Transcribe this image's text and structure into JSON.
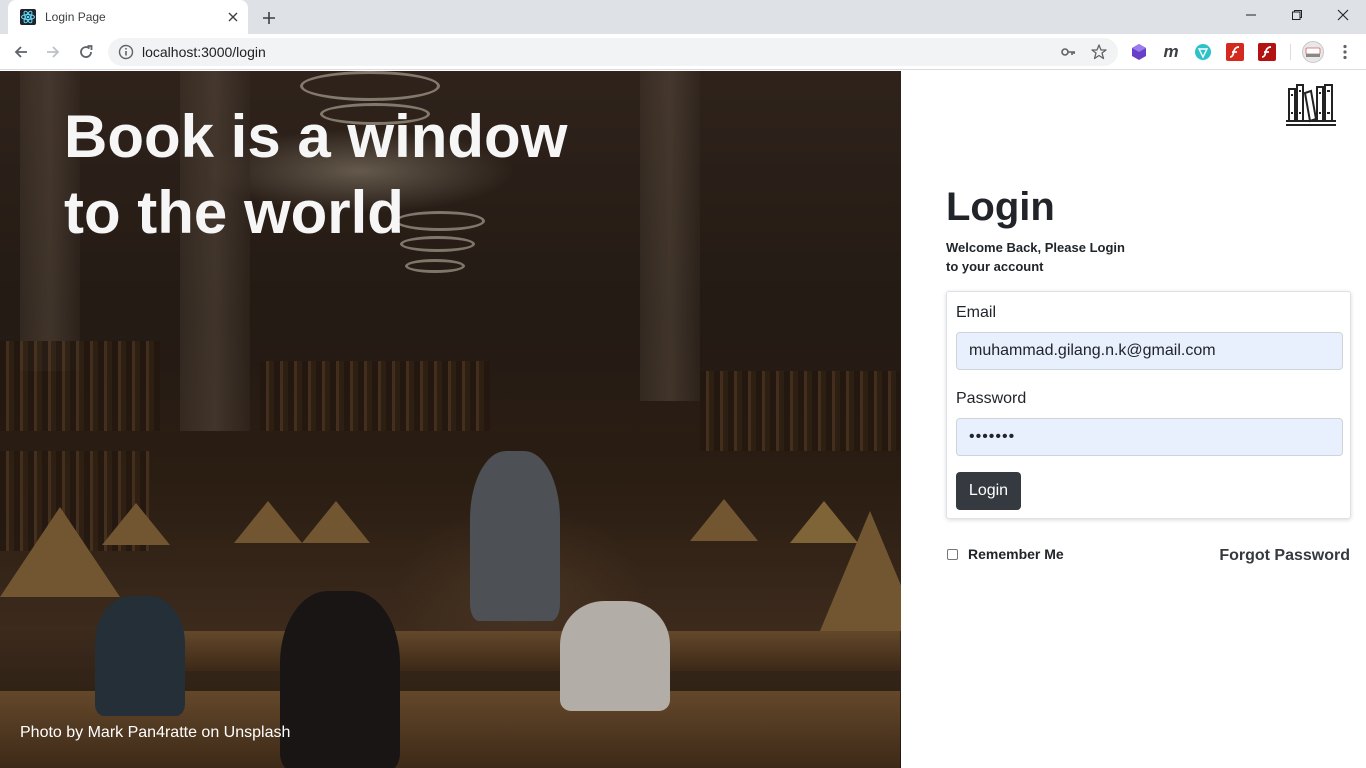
{
  "browser": {
    "tab_title": "Login Page",
    "url": "localhost:3000/login"
  },
  "hero": {
    "heading_line1": "Book is a window",
    "heading_line2": "to the world",
    "photo_credit": "Photo by Mark Pan4ratte on Unsplash"
  },
  "login": {
    "title": "Login",
    "welcome_line1": "Welcome Back, Please Login",
    "welcome_line2": "to your account",
    "email_label": "Email",
    "email_value": "muhammad.gilang.n.k@gmail.com",
    "password_label": "Password",
    "password_value": "•••••••",
    "submit_label": "Login",
    "remember_label": "Remember Me",
    "forgot_label": "Forgot Password"
  },
  "colors": {
    "button_bg": "#343a40",
    "input_autofill_bg": "#e8f0fe",
    "tab_strip": "#dee1e6"
  },
  "icons": [
    "react-favicon",
    "close-icon",
    "plus-icon",
    "back-arrow-icon",
    "forward-arrow-icon",
    "reload-icon",
    "info-icon",
    "key-icon",
    "star-icon",
    "library-logo-icon"
  ]
}
